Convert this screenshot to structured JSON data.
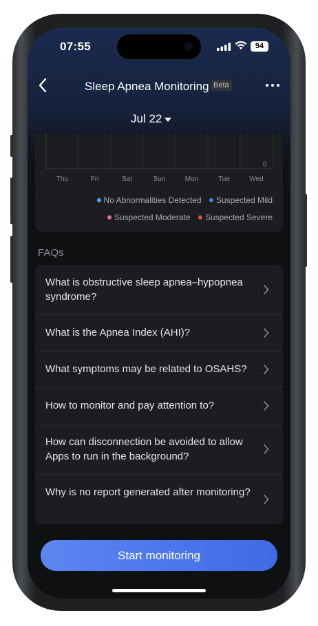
{
  "status_bar": {
    "time": "07:55",
    "battery": "94"
  },
  "header": {
    "title": "Sleep Apnea Monitoring",
    "badge": "Beta"
  },
  "date_selector": {
    "label": "Jul 22"
  },
  "chart_data": {
    "type": "bar",
    "categories": [
      "Thu",
      "Fri",
      "Sat",
      "Sun",
      "Mon",
      "Tue",
      "Wed"
    ],
    "series": [
      {
        "name": "No Abnormalities Detected",
        "color": "#45a8e8",
        "values": [
          0,
          0,
          0,
          0,
          0,
          0,
          0
        ]
      },
      {
        "name": "Suspected Mild",
        "color": "#4d7ee0",
        "values": [
          0,
          0,
          0,
          0,
          0,
          0,
          0
        ]
      },
      {
        "name": "Suspected Moderate",
        "color": "#e86aa7",
        "values": [
          0,
          0,
          0,
          0,
          0,
          0,
          0
        ]
      },
      {
        "name": "Suspected Severe",
        "color": "#e8485a",
        "values": [
          0,
          0,
          0,
          0,
          0,
          0,
          0
        ]
      }
    ],
    "y_tick_visible": "0",
    "grid": true
  },
  "faq": {
    "title": "FAQs",
    "items": [
      {
        "label": "What is obstructive sleep apnea–hypopnea syndrome?"
      },
      {
        "label": "What is the Apnea Index (AHI)?"
      },
      {
        "label": "What symptoms may be related to OSAHS?"
      },
      {
        "label": "How to monitor and pay attention to?"
      },
      {
        "label": "How can disconnection be avoided to allow Apps to run in the background?"
      },
      {
        "label": "Why is no report generated after monitoring?"
      }
    ]
  },
  "actions": {
    "start_label": "Start monitoring",
    "accent": "#4f7bed"
  }
}
